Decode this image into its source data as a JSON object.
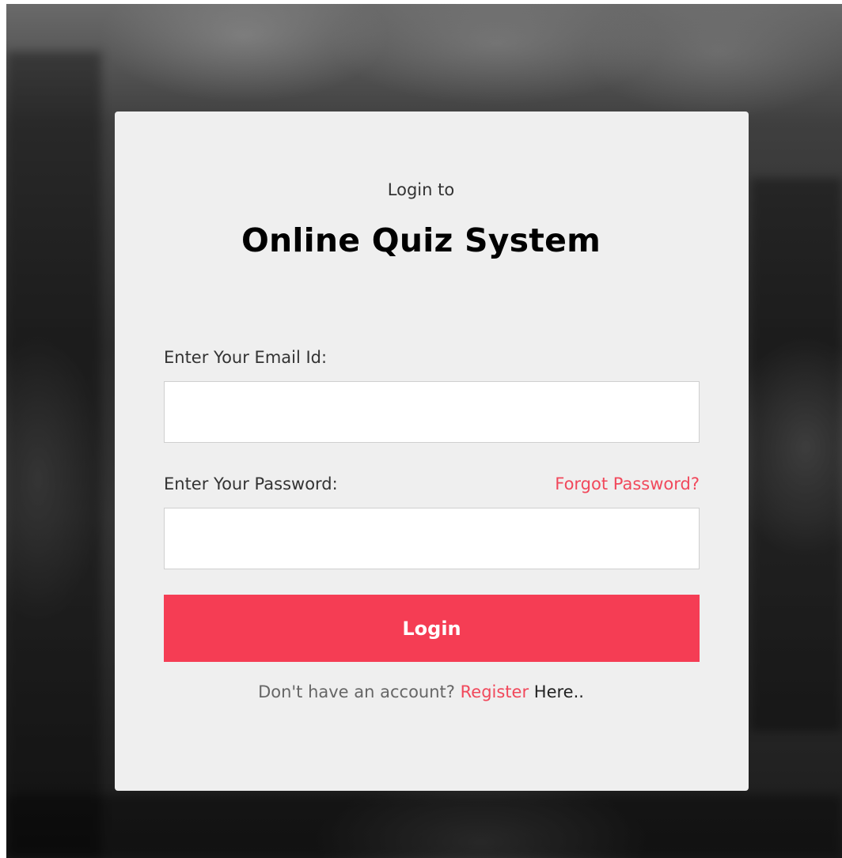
{
  "header": {
    "subtitle": "Login to",
    "title": "Online Quiz System"
  },
  "form": {
    "email_label": "Enter Your Email Id:",
    "email_value": "",
    "email_placeholder": "",
    "password_label": "Enter Your Password:",
    "password_value": "",
    "password_placeholder": "",
    "forgot_link": "Forgot Password?",
    "login_label": "Login"
  },
  "footer": {
    "prompt": "Don't have an account?",
    "register_link": "Register",
    "suffix": "Here.."
  },
  "colors": {
    "accent": "#f53d54",
    "link": "#f1485b",
    "card_background": "#efefef"
  }
}
